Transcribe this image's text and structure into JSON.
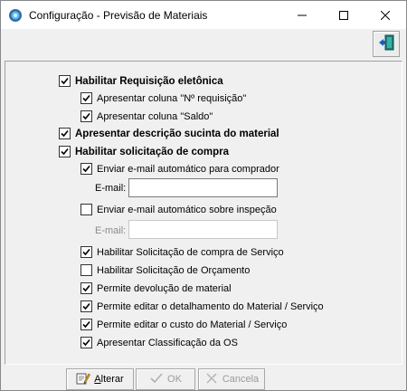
{
  "window": {
    "title": "Configuração - Previsão de Materiais"
  },
  "toolbar": {
    "exit_icon": "exit-door-icon"
  },
  "options": [
    {
      "key": "req_eletronica",
      "label": "Habilitar Requisição eletônica",
      "checked": true,
      "bold": true
    },
    {
      "key": "col_num_req",
      "label": "Apresentar coluna \"Nº requisição\"",
      "checked": true,
      "bold": false
    },
    {
      "key": "col_saldo",
      "label": "Apresentar coluna \"Saldo\"",
      "checked": true,
      "bold": false
    },
    {
      "key": "desc_sucinta",
      "label": "Apresentar descrição sucinta do material",
      "checked": true,
      "bold": true
    },
    {
      "key": "sol_compra",
      "label": "Habilitar solicitação de compra",
      "checked": true,
      "bold": true
    },
    {
      "key": "email_comprador",
      "label": "Enviar e-mail automático para comprador",
      "checked": true,
      "bold": false
    },
    {
      "key": "email_inspecao",
      "label": "Enviar e-mail automático sobre inspeção",
      "checked": false,
      "bold": false
    },
    {
      "key": "sol_servico",
      "label": "Habilitar Solicitação de compra de Serviço",
      "checked": true,
      "bold": false
    },
    {
      "key": "sol_orcamento",
      "label": "Habilitar Solicitação de Orçamento",
      "checked": false,
      "bold": false
    },
    {
      "key": "devolucao",
      "label": "Permite devolução de material",
      "checked": true,
      "bold": false
    },
    {
      "key": "editar_detalhamento",
      "label": "Permite editar o detalhamento do Material / Serviço",
      "checked": true,
      "bold": false
    },
    {
      "key": "editar_custo",
      "label": "Permite editar o custo do Material / Serviço",
      "checked": true,
      "bold": false
    },
    {
      "key": "classificacao_os",
      "label": "Apresentar Classificação da OS",
      "checked": true,
      "bold": false
    }
  ],
  "email_fields": {
    "comprador": {
      "label": "E-mail:",
      "value": "",
      "enabled": true
    },
    "inspecao": {
      "label": "E-mail:",
      "value": "",
      "enabled": false
    }
  },
  "buttons": {
    "alterar": {
      "label_prefix": "",
      "label_accel": "A",
      "label_rest": "lterar",
      "enabled": true,
      "icon": "edit-pencil-icon"
    },
    "ok": {
      "label": "OK",
      "enabled": false,
      "icon": "check-icon"
    },
    "cancela": {
      "label": "Cancela",
      "enabled": false,
      "icon": "cancel-x-icon"
    }
  },
  "colors": {
    "window_bg": "#f0f0f0",
    "titlebar_bg": "#ffffff",
    "disabled_text": "#9a9a9a"
  }
}
